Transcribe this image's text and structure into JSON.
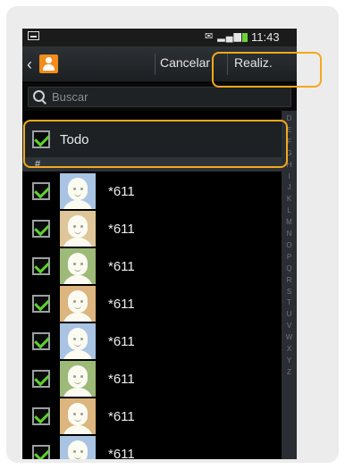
{
  "status_bar": {
    "time": "11:43",
    "icons_text": "✉ ▂▄▆"
  },
  "action_bar": {
    "cancel_label": "Cancelar",
    "done_label": "Realiz."
  },
  "search": {
    "placeholder": "Buscar"
  },
  "select_all": {
    "label": "Todo",
    "checked": true
  },
  "section": {
    "header": "#"
  },
  "contacts": [
    {
      "name": "*611",
      "checked": true,
      "avatar_color": "#a9c3e2"
    },
    {
      "name": "*611",
      "checked": true,
      "avatar_color": "#dfc59a"
    },
    {
      "name": "*611",
      "checked": true,
      "avatar_color": "#9dba79"
    },
    {
      "name": "*611",
      "checked": true,
      "avatar_color": "#dcb57f"
    },
    {
      "name": "*611",
      "checked": true,
      "avatar_color": "#a9c3e2"
    },
    {
      "name": "*611",
      "checked": true,
      "avatar_color": "#9dba79"
    },
    {
      "name": "*611",
      "checked": true,
      "avatar_color": "#dcb57f"
    },
    {
      "name": "*611",
      "checked": true,
      "avatar_color": "#a9c3e2"
    }
  ],
  "index_letters": [
    "D",
    "E",
    "F",
    "G",
    "H",
    "I",
    "J",
    "K",
    "L",
    "M",
    "N",
    "O",
    "P",
    "Q",
    "R",
    "S",
    "T",
    "U",
    "V",
    "W",
    "X",
    "Y",
    "Z"
  ],
  "colors": {
    "accent_check": "#5ed12c",
    "highlight": "#f5a81b",
    "contact_icon": "#f28c1c"
  }
}
